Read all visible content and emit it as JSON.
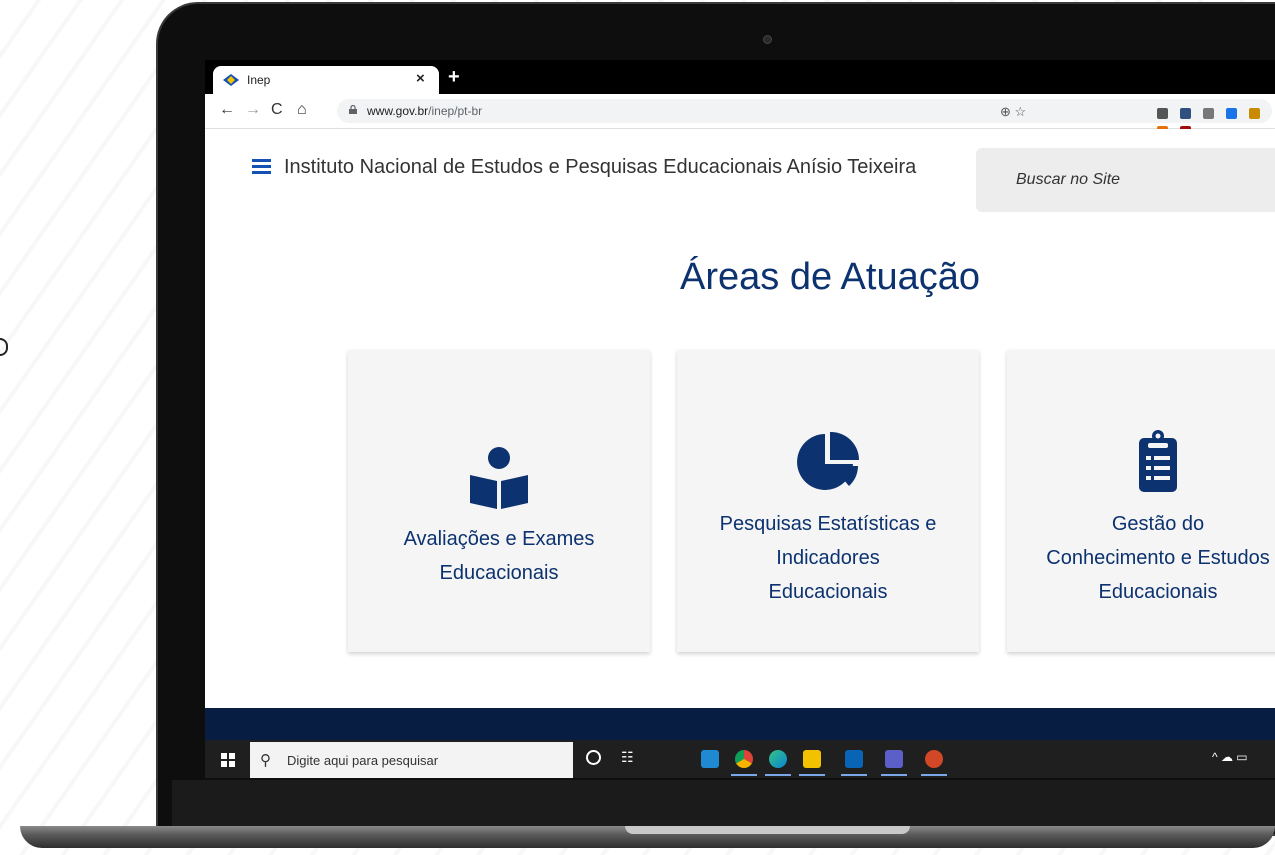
{
  "browser": {
    "tab": {
      "title": "Inep",
      "close_glyph": "×"
    },
    "new_tab_glyph": "+",
    "nav": {
      "back": "←",
      "forward": "→",
      "reload": "C",
      "home": "⌂"
    },
    "url": {
      "host": "www.gov.br",
      "path": "/inep/pt-br"
    },
    "omnibox_icons": "⊕  ☆",
    "extension_colors": [
      "#555555",
      "#2f4f7f",
      "#777777",
      "#1a73e8",
      "#c88a00",
      "#e8710a",
      "#a50e0e"
    ]
  },
  "site": {
    "title": "Instituto Nacional de Estudos e Pesquisas Educacionais Anísio Teixeira",
    "search_placeholder": "Buscar no Site",
    "accent_color": "#1351b4",
    "heading_color": "#0c326f"
  },
  "main": {
    "section_title": "Áreas de Atuação",
    "cards": [
      {
        "icon": "reader-book-icon",
        "label": "Avaliações e Exames\nEducacionais"
      },
      {
        "icon": "pie-chart-icon",
        "label": "Pesquisas Estatísticas e\nIndicadores\nEducacionais"
      },
      {
        "icon": "clipboard-list-icon",
        "label": "Gestão do\nConhecimento e Estudos\nEducacionais"
      }
    ]
  },
  "taskbar": {
    "search_placeholder": "Digite aqui para pesquisar",
    "apps": [
      "vscode-icon",
      "chrome-icon",
      "edge-icon",
      "file-explorer-icon",
      "outlook-icon",
      "teams-icon",
      "powerpoint-icon"
    ],
    "tray": "^ ☁ ▭"
  }
}
